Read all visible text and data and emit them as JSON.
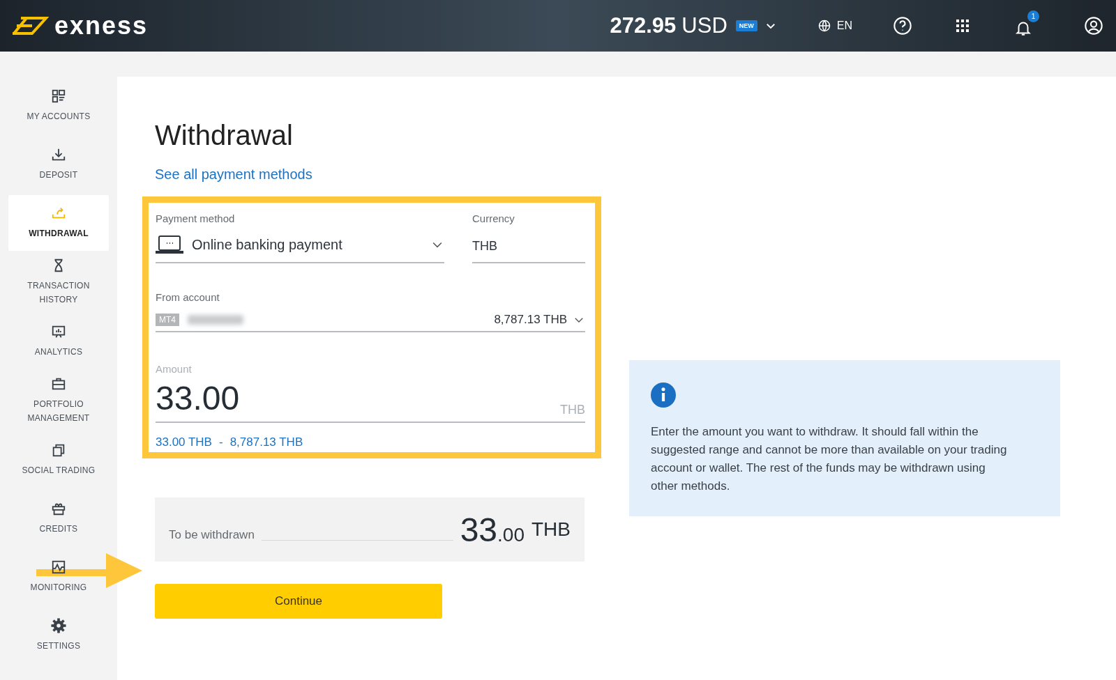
{
  "header": {
    "logo": "exness",
    "balance": "272.95",
    "balance_currency": "USD",
    "new_badge": "NEW",
    "language": "EN",
    "notification_count": "1"
  },
  "sidebar": {
    "items": [
      {
        "kind": "accounts",
        "label": "MY ACCOUNTS",
        "selected": false
      },
      {
        "kind": "deposit",
        "label": "DEPOSIT",
        "selected": false
      },
      {
        "kind": "withdrawal",
        "label": "WITHDRAWAL",
        "selected": true
      },
      {
        "kind": "history",
        "label": "TRANSACTION HISTORY",
        "selected": false
      },
      {
        "kind": "analytics",
        "label": "ANALYTICS",
        "selected": false
      },
      {
        "kind": "portfolio",
        "label": "PORTFOLIO MANAGEMENT",
        "selected": false
      },
      {
        "kind": "social",
        "label": "SOCIAL TRADING",
        "selected": false
      },
      {
        "kind": "credits",
        "label": "CREDITS",
        "selected": false
      },
      {
        "kind": "monitoring",
        "label": "MONITORING",
        "selected": false
      },
      {
        "kind": "settings",
        "label": "SETTINGS",
        "selected": false
      }
    ]
  },
  "page": {
    "title": "Withdrawal",
    "payment_methods_link": "See all payment methods"
  },
  "form": {
    "payment_method": {
      "label": "Payment method",
      "value": "Online banking payment"
    },
    "currency": {
      "label": "Currency",
      "value": "THB"
    },
    "from_account": {
      "label": "From account",
      "platform": "MT4",
      "balance": "8,787.13 THB"
    },
    "amount": {
      "label": "Amount",
      "value": "33.00",
      "currency": "THB"
    },
    "range": {
      "min": "33.00 THB",
      "separator": "-",
      "max": "8,787.13 THB"
    }
  },
  "summary": {
    "label": "To be withdrawn",
    "amount_whole": "33",
    "amount_fraction": ".00",
    "currency": "THB"
  },
  "continue_button": "Continue",
  "info": {
    "text": "Enter the amount you want to withdraw. It should fall within the suggested range and cannot be more than available on your trading account or wallet. The rest of the funds may be withdrawn using other methods."
  }
}
